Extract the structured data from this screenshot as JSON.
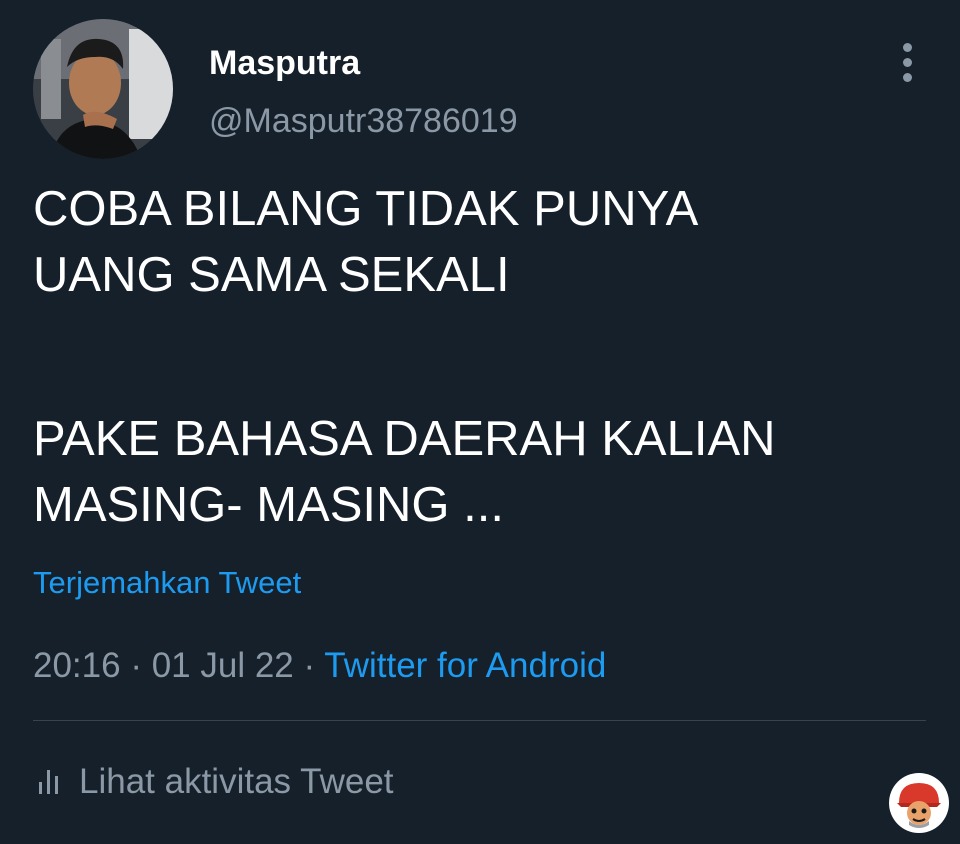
{
  "tweet": {
    "author": {
      "display_name": "Masputra",
      "handle": "@Masputr38786019"
    },
    "text_lines": [
      "COBA BILANG TIDAK PUNYA",
      "UANG SAMA SEKALI",
      "PAKE BAHASA DAERAH KALIAN",
      "MASING- MASING ..."
    ],
    "translate_label": "Terjemahkan Tweet",
    "time": "20:16",
    "separator": " · ",
    "date": "01 Jul 22",
    "source": "Twitter for Android",
    "activity_label": "Lihat aktivitas Tweet"
  },
  "icons": {
    "more": "more-vertical-icon",
    "activity": "bar-chart-icon"
  },
  "colors": {
    "background": "#15202b",
    "text_primary": "#ffffff",
    "text_secondary": "#8b98a5",
    "link": "#1d9bf0",
    "divider": "#38444d"
  }
}
